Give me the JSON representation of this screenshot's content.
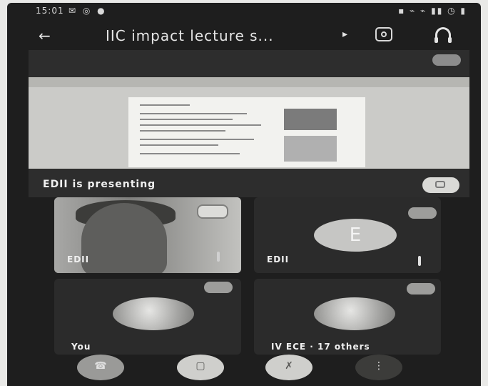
{
  "status": {
    "time": "15:01",
    "left_icons": "✉ ◎ ●",
    "right_icons": "▪ ⌁ ⌁ ▮▮ ◷ ▮"
  },
  "appbar": {
    "back_icon": "arrow-left-icon",
    "title": "IIC impact lecture s...",
    "switch_camera_icon": "switch-camera-icon",
    "audio_icon": "headphones-icon"
  },
  "presentation": {
    "presenter_text": "EDII is presenting",
    "pin_icon": "fullscreen-icon"
  },
  "participants": [
    {
      "name": "EDII",
      "kind": "video"
    },
    {
      "name": "EDII",
      "kind": "avatar",
      "initial": "E"
    },
    {
      "name": "You",
      "kind": "photo"
    },
    {
      "name": "IV ECE · 17 others",
      "kind": "photo"
    }
  ],
  "controls": {
    "end_call_icon": "end-call-icon",
    "camera_icon": "camera-off-icon",
    "mic_icon": "mic-off-icon",
    "more_icon": "more-options-icon"
  }
}
